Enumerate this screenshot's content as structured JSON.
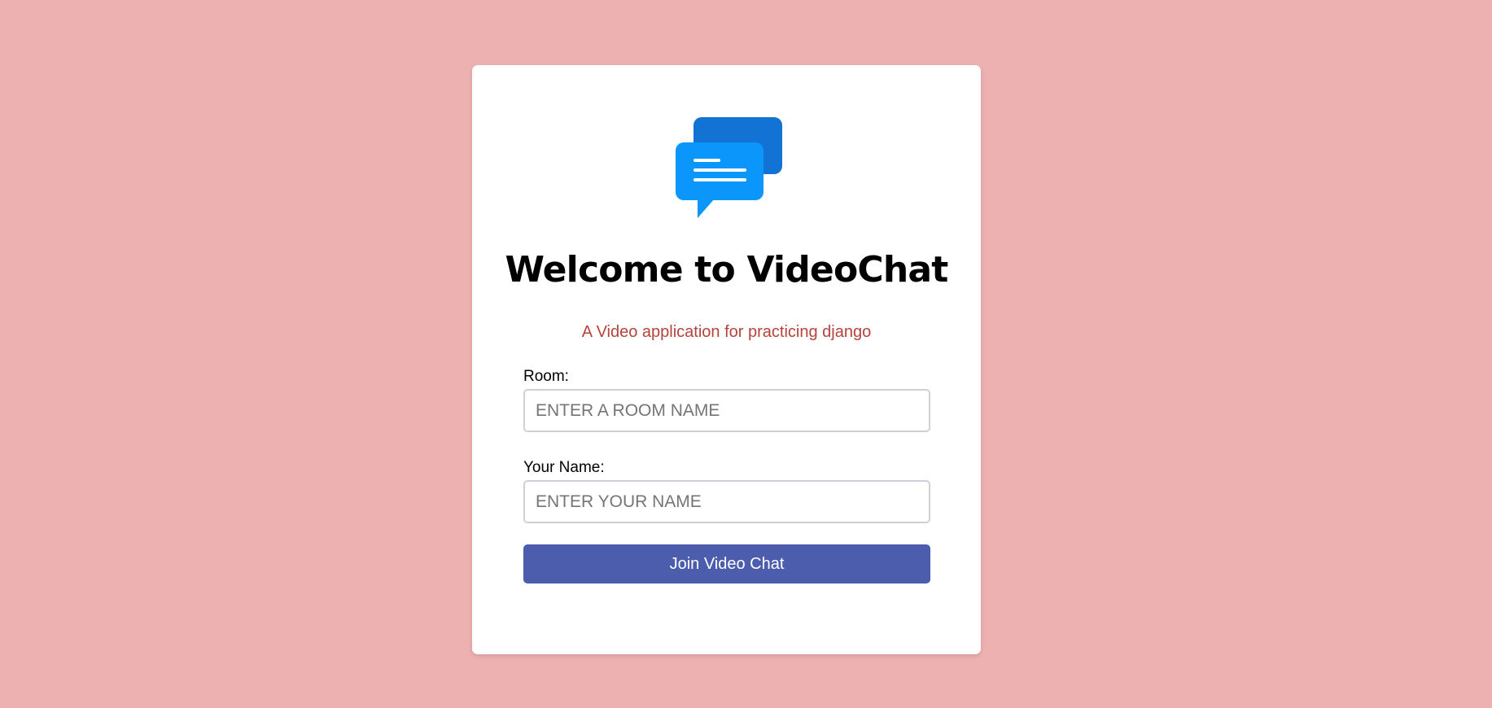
{
  "app": {
    "title": "Welcome to VideoChat",
    "subtitle": "A Video application for practicing django",
    "logo_icon": "chat-bubbles-icon"
  },
  "form": {
    "room": {
      "label": "Room:",
      "placeholder": "ENTER A ROOM NAME",
      "value": ""
    },
    "name": {
      "label": "Your Name:",
      "placeholder": "ENTER YOUR NAME",
      "value": ""
    },
    "submit_label": "Join Video Chat"
  },
  "colors": {
    "background": "#edb1b1",
    "card": "#ffffff",
    "subtitle": "#b5433c",
    "button": "#4c5dad",
    "icon_front": "#0a96fa",
    "icon_back": "#1273d4"
  }
}
